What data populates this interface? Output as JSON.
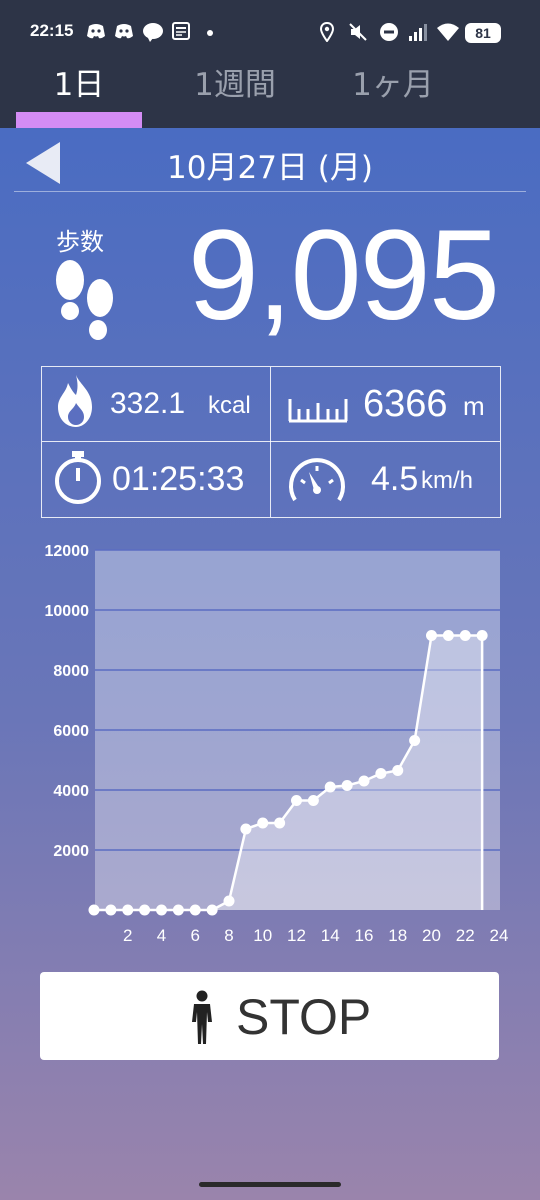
{
  "status_bar": {
    "time": "22:15",
    "battery": "81",
    "icons": [
      "discord-icon",
      "discord-icon",
      "line-icon",
      "news-icon",
      "dot-icon",
      "location-icon",
      "mute-icon",
      "dnd-icon",
      "signal-icon",
      "wifi-icon"
    ]
  },
  "tabs": [
    {
      "label": "1日",
      "active": true
    },
    {
      "label": "1週間",
      "active": false
    },
    {
      "label": "1ヶ月",
      "active": false
    }
  ],
  "colors": {
    "header_bg": "#2d3447",
    "tab_indicator": "#d48cf5",
    "gradient_top": "#4a6cc2",
    "gradient_bottom": "#9a84ac"
  },
  "date": "10月27日 (月)",
  "steps": {
    "label": "歩数",
    "value": "9,095"
  },
  "stats": {
    "calories": {
      "value": "332.1",
      "unit": "kcal"
    },
    "distance": {
      "value": "6366",
      "unit": "m"
    },
    "duration": {
      "value": "01:25:33",
      "unit": ""
    },
    "speed": {
      "value": "4.5",
      "unit": "km/h"
    }
  },
  "chart_data": {
    "type": "area",
    "title": "",
    "xlabel": "",
    "ylabel": "",
    "x_ticks": [
      "2",
      "4",
      "6",
      "8",
      "10",
      "12",
      "14",
      "16",
      "18",
      "20",
      "22",
      "24"
    ],
    "y_ticks": [
      "2000",
      "4000",
      "6000",
      "8000",
      "10000",
      "12000"
    ],
    "xlim": [
      0,
      24
    ],
    "ylim": [
      0,
      12000
    ],
    "x": [
      0,
      1,
      2,
      3,
      4,
      5,
      6,
      7,
      8,
      9,
      10,
      11,
      12,
      13,
      14,
      15,
      16,
      17,
      18,
      19,
      20,
      21,
      22,
      23
    ],
    "y": [
      0,
      0,
      0,
      0,
      0,
      0,
      0,
      0,
      300,
      2700,
      2900,
      2900,
      3650,
      3650,
      4100,
      4150,
      4300,
      4550,
      4650,
      5650,
      9150,
      9150,
      9150,
      9150
    ],
    "grid": true,
    "legend": "none"
  },
  "stop_button": {
    "label": "STOP"
  }
}
